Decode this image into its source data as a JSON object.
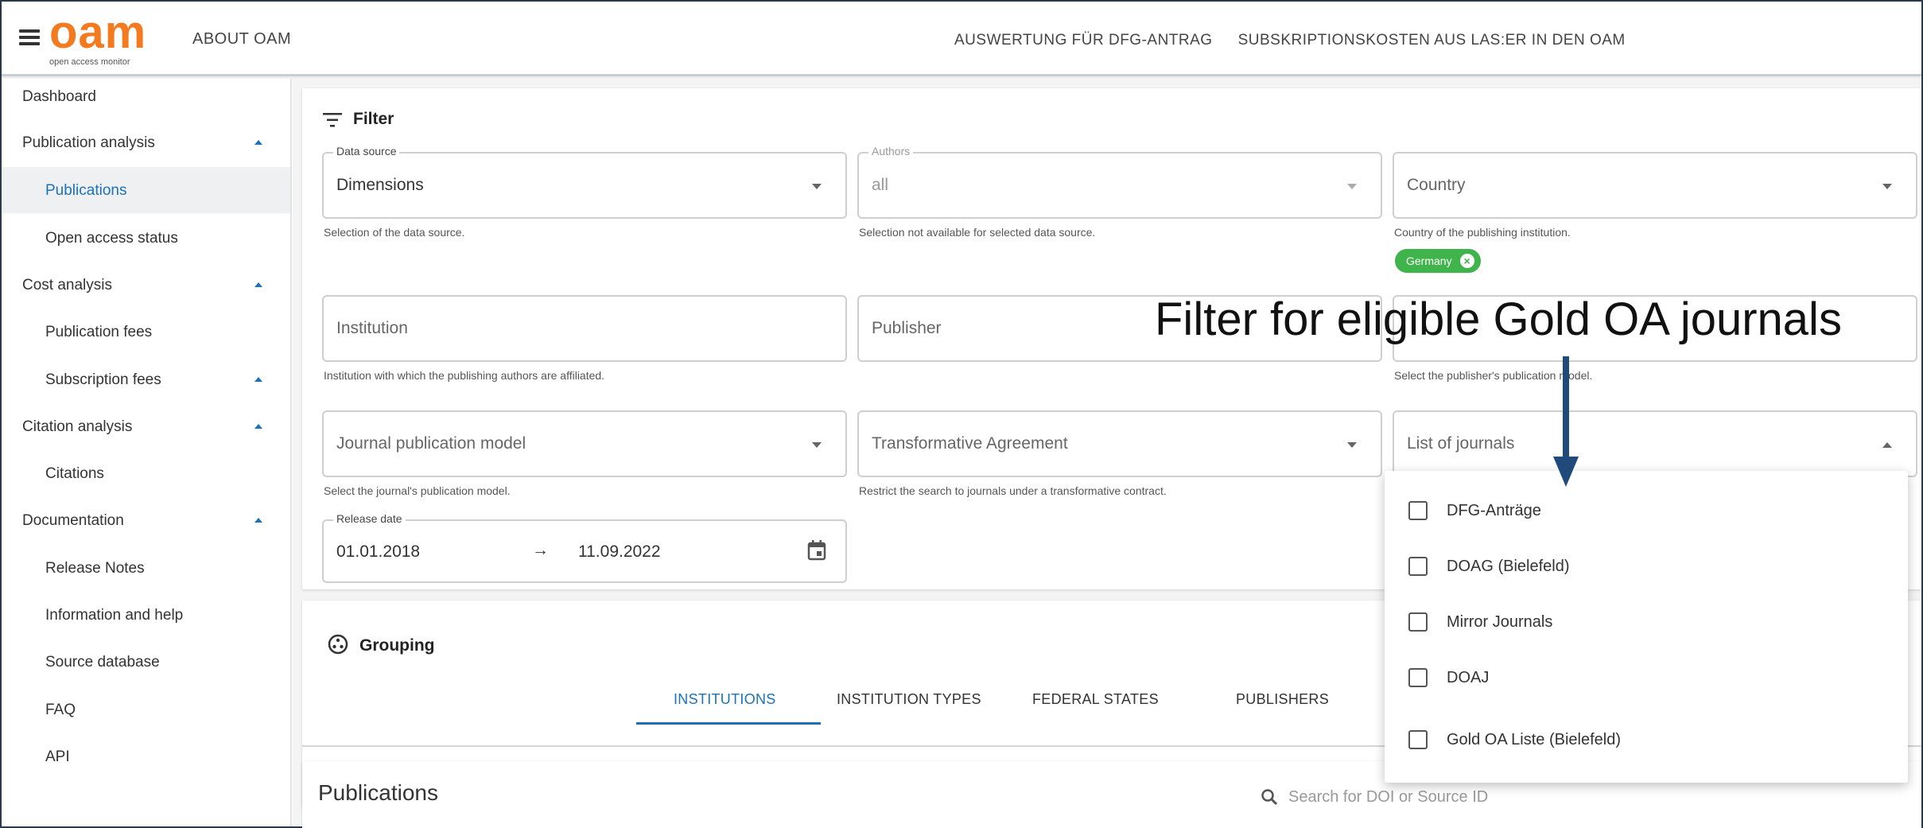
{
  "header": {
    "menu_icon": "hamburger-icon",
    "logo_text": "oam",
    "logo_subtitle": "open access monitor",
    "about": "ABOUT OAM",
    "nav": [
      "AUSWERTUNG FÜR DFG-ANTRAG",
      "SUBSKRIPTIONSKOSTEN AUS LAS:ER IN DEN OAM"
    ]
  },
  "sidebar": {
    "dashboard": "Dashboard",
    "publication_analysis": "Publication analysis",
    "publications": "Publications",
    "open_access_status": "Open access status",
    "cost_analysis": "Cost analysis",
    "publication_fees": "Publication fees",
    "subscription_fees": "Subscription fees",
    "citation_analysis": "Citation analysis",
    "citations": "Citations",
    "documentation": "Documentation",
    "release_notes": "Release Notes",
    "information_help": "Information and help",
    "source_database": "Source database",
    "faq": "FAQ",
    "api": "API"
  },
  "filter": {
    "title": "Filter",
    "data_source": {
      "legend": "Data source",
      "value": "Dimensions",
      "hint": "Selection of the data source."
    },
    "authors": {
      "legend": "Authors",
      "value": "all",
      "hint": "Selection not available for selected data source."
    },
    "country": {
      "placeholder": "Country",
      "hint": "Country of the publishing institution.",
      "chip": "Germany"
    },
    "institution": {
      "placeholder": "Institution",
      "hint": "Institution with which the publishing authors are affiliated."
    },
    "publisher": {
      "placeholder": "Publisher"
    },
    "publisher_model_hint": "Select the publisher's publication model.",
    "journal_model": {
      "placeholder": "Journal publication model",
      "hint": "Select the journal's publication model."
    },
    "transformative": {
      "placeholder": "Transformative Agreement",
      "hint": "Restrict the search to journals under a transformative contract."
    },
    "list_of_journals": {
      "placeholder": "List of journals"
    },
    "release_date": {
      "legend": "Release date",
      "from": "01.01.2018",
      "arrow": "→",
      "to": "11.09.2022"
    }
  },
  "journal_options": [
    "DFG-Anträge",
    "DOAG (Bielefeld)",
    "Mirror Journals",
    "DOAJ",
    "Gold OA Liste (Bielefeld)"
  ],
  "grouping": {
    "title": "Grouping",
    "tabs": [
      "INSTITUTIONS",
      "INSTITUTION TYPES",
      "FEDERAL STATES",
      "PUBLISHERS"
    ]
  },
  "publications": {
    "title": "Publications",
    "search_placeholder": "Search for DOI or Source ID"
  },
  "annotation": "Filter for eligible Gold OA journals",
  "colors": {
    "accent": "#1c72b8",
    "logo": "#f47a20",
    "chip": "#3fb44a",
    "arrow": "#1f4a7a"
  }
}
